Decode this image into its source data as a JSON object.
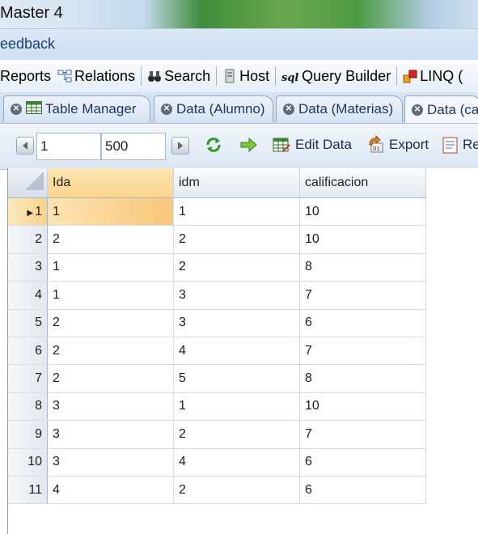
{
  "window": {
    "title": "Master 4"
  },
  "menu": {
    "label": "eedback"
  },
  "ribbon": {
    "items": [
      {
        "label": "Reports",
        "icon": "reports-icon"
      },
      {
        "label": "Relations",
        "icon": "relations-icon"
      },
      {
        "label": "Search",
        "icon": "binoculars-icon"
      },
      {
        "label": "Host",
        "icon": "host-icon"
      },
      {
        "label": "Query Builder",
        "icon": "sql-icon"
      },
      {
        "label": "LINQ (",
        "icon": "linq-icon"
      }
    ]
  },
  "tabs": [
    {
      "label": "Table Manager",
      "icon": "table-icon"
    },
    {
      "label": "Data (Alumno)"
    },
    {
      "label": "Data (Materias)"
    },
    {
      "label": "Data (ca"
    }
  ],
  "toolbar": {
    "start_value": "1",
    "count_value": "500",
    "edit_label": "Edit Data",
    "export_label": "Export",
    "re_label": "Re"
  },
  "grid": {
    "columns": [
      "Ida",
      "idm",
      "calificacion"
    ],
    "rows": [
      {
        "n": "1",
        "cells": [
          "1",
          "1",
          "10"
        ]
      },
      {
        "n": "2",
        "cells": [
          "2",
          "2",
          "10"
        ]
      },
      {
        "n": "3",
        "cells": [
          "1",
          "2",
          "8"
        ]
      },
      {
        "n": "4",
        "cells": [
          "1",
          "3",
          "7"
        ]
      },
      {
        "n": "5",
        "cells": [
          "2",
          "3",
          "6"
        ]
      },
      {
        "n": "6",
        "cells": [
          "2",
          "4",
          "7"
        ]
      },
      {
        "n": "7",
        "cells": [
          "2",
          "5",
          "8"
        ]
      },
      {
        "n": "8",
        "cells": [
          "3",
          "1",
          "10"
        ]
      },
      {
        "n": "9",
        "cells": [
          "3",
          "2",
          "7"
        ]
      },
      {
        "n": "10",
        "cells": [
          "3",
          "4",
          "6"
        ]
      },
      {
        "n": "11",
        "cells": [
          "4",
          "2",
          "6"
        ]
      }
    ]
  },
  "colors": {
    "selection": "#f8c77a",
    "header_active": "#fbd48a",
    "chrome": "#c9daee"
  }
}
